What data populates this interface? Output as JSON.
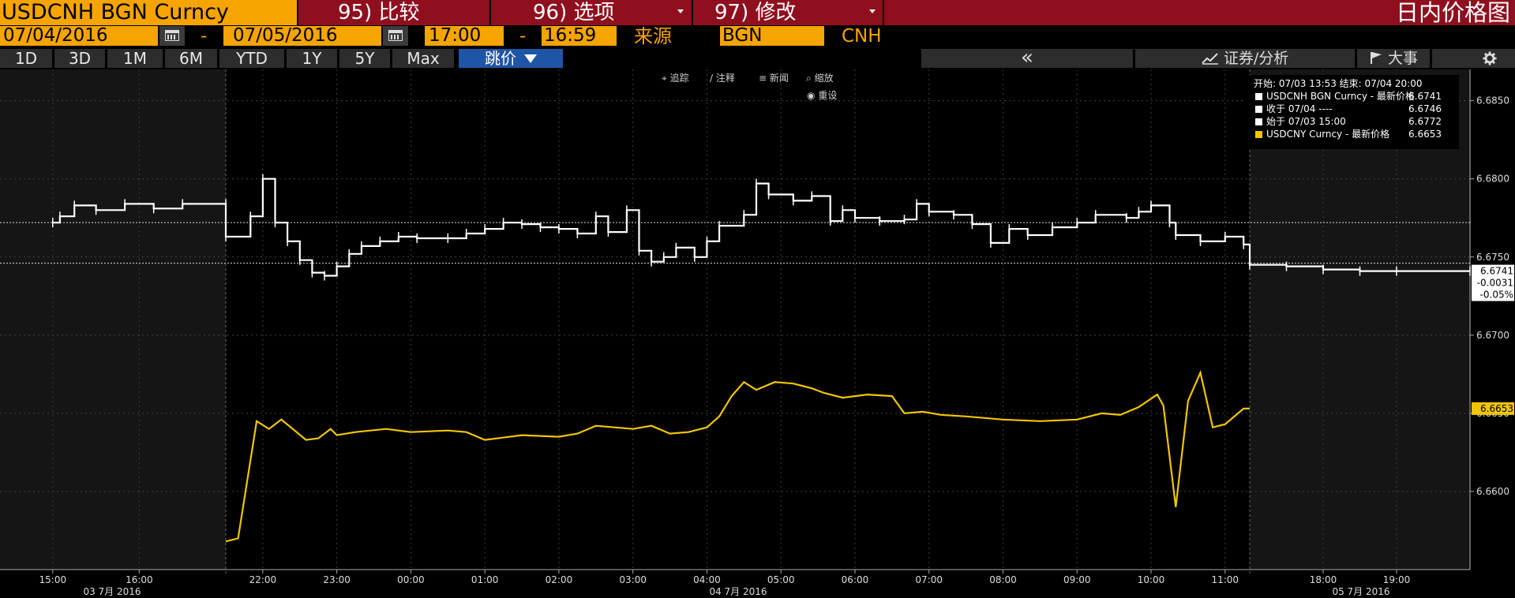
{
  "topbar": {
    "ticker": "USDCNH BGN Curncy",
    "menu": [
      {
        "num": "95)",
        "label": "比较"
      },
      {
        "num": "96)",
        "label": "选项"
      },
      {
        "num": "97)",
        "label": "修改"
      }
    ],
    "title": "日内价格图"
  },
  "range": {
    "start_date": "07/04/2016",
    "end_date": "07/05/2016",
    "start_time": "17:00",
    "end_time": "16:59",
    "dash": "-",
    "source_label": "来源",
    "source_value": "BGN",
    "currency": "CNH"
  },
  "periods": [
    "1D",
    "3D",
    "1M",
    "6M",
    "YTD",
    "1Y",
    "5Y",
    "Max"
  ],
  "mode_button": "跳价",
  "right_toolbar": {
    "collapse": "«",
    "analysis": "证券/分析",
    "events": "大事",
    "settings_icon": "gear-icon"
  },
  "chart_tools": {
    "track": "追踪",
    "annotate": "注释",
    "news": "新闻",
    "zoom": "缩放",
    "reset": "重设"
  },
  "legend": {
    "header": "开始: 07/03 13:53 结束: 07/04 20:00",
    "rows": [
      {
        "label": "USDCNH BGN Curncy - 最新价格",
        "value": "6.6741",
        "color": "#ffffff"
      },
      {
        "label": "收于 07/04 ----",
        "value": "6.6746",
        "color": "#ffffff"
      },
      {
        "label": "始于 07/03 15:00",
        "value": "6.6772",
        "color": "#ffffff"
      },
      {
        "label": "USDCNY Curncy - 最新价格",
        "value": "6.6653",
        "color": "#f2c500"
      }
    ]
  },
  "colors": {
    "cnh_line": "#ffffff",
    "cny_line": "#f2c500",
    "amber": "#f5a400",
    "topbar": "#8f0f1f"
  },
  "chart_data": {
    "type": "line",
    "y_axis": {
      "ylim": [
        6.655,
        6.687
      ],
      "ticks": [
        "6.6850",
        "6.6800",
        "6.6750",
        "6.6700",
        "6.6650",
        "6.6600"
      ],
      "position": "right"
    },
    "x_axis": {
      "ticks": [
        "15:00",
        "16:00",
        "22:00",
        "23:00",
        "00:00",
        "01:00",
        "02:00",
        "03:00",
        "04:00",
        "05:00",
        "06:00",
        "07:00",
        "08:00",
        "09:00",
        "10:00",
        "11:00",
        "18:00",
        "19:00"
      ],
      "date_labels": [
        "03 7月 2016",
        "04 7月 2016",
        "05 7月 2016"
      ]
    },
    "last_value_tags": [
      {
        "text": "6.6741",
        "series": "USDCNH BGN Curncy"
      },
      {
        "text": "-0.0031",
        "series": "USDCNH BGN Curncy"
      },
      {
        "text": "-0.05%",
        "series": "USDCNH BGN Curncy"
      },
      {
        "text": "6.6653",
        "series": "USDCNY Curncy"
      }
    ],
    "reference_lines": [
      6.6772,
      6.6746
    ],
    "series": [
      {
        "name": "USDCNH BGN Curncy",
        "color": "#ffffff",
        "step": true,
        "points": [
          [
            "15:00",
            6.6772
          ],
          [
            "15:05",
            6.6776
          ],
          [
            "15:15",
            6.6783
          ],
          [
            "15:30",
            6.678
          ],
          [
            "15:50",
            6.6784
          ],
          [
            "16:10",
            6.6781
          ],
          [
            "16:30",
            6.6784
          ],
          [
            "17:00",
            6.6784
          ],
          [
            "21:30",
            6.6763
          ],
          [
            "21:50",
            6.6776
          ],
          [
            "22:00",
            6.68
          ],
          [
            "22:10",
            6.6772
          ],
          [
            "22:20",
            6.676
          ],
          [
            "22:30",
            6.6748
          ],
          [
            "22:40",
            6.674
          ],
          [
            "22:50",
            6.6738
          ],
          [
            "23:00",
            6.6744
          ],
          [
            "23:10",
            6.6752
          ],
          [
            "23:20",
            6.6757
          ],
          [
            "23:35",
            6.676
          ],
          [
            "23:50",
            6.6763
          ],
          [
            "00:05",
            6.6762
          ],
          [
            "00:30",
            6.6762
          ],
          [
            "00:45",
            6.6765
          ],
          [
            "01:00",
            6.6768
          ],
          [
            "01:15",
            6.6772
          ],
          [
            "01:30",
            6.6771
          ],
          [
            "01:45",
            6.6769
          ],
          [
            "02:00",
            6.6768
          ],
          [
            "02:15",
            6.6765
          ],
          [
            "02:30",
            6.6776
          ],
          [
            "02:40",
            6.6766
          ],
          [
            "02:55",
            6.678
          ],
          [
            "03:05",
            6.6754
          ],
          [
            "03:15",
            6.6747
          ],
          [
            "03:25",
            6.675
          ],
          [
            "03:35",
            6.6756
          ],
          [
            "03:50",
            6.675
          ],
          [
            "04:00",
            6.676
          ],
          [
            "04:10",
            6.677
          ],
          [
            "04:30",
            6.6777
          ],
          [
            "04:40",
            6.6797
          ],
          [
            "04:50",
            6.679
          ],
          [
            "05:10",
            6.6786
          ],
          [
            "05:25",
            6.6789
          ],
          [
            "05:40",
            6.6773
          ],
          [
            "05:50",
            6.678
          ],
          [
            "06:00",
            6.6775
          ],
          [
            "06:20",
            6.6773
          ],
          [
            "06:40",
            6.6774
          ],
          [
            "06:50",
            6.6784
          ],
          [
            "07:00",
            6.6779
          ],
          [
            "07:20",
            6.6777
          ],
          [
            "07:35",
            6.6771
          ],
          [
            "07:50",
            6.6759
          ],
          [
            "08:05",
            6.6768
          ],
          [
            "08:20",
            6.6764
          ],
          [
            "08:40",
            6.6769
          ],
          [
            "09:00",
            6.6772
          ],
          [
            "09:15",
            6.6777
          ],
          [
            "09:40",
            6.6775
          ],
          [
            "09:50",
            6.6779
          ],
          [
            "10:00",
            6.6783
          ],
          [
            "10:15",
            6.6772
          ],
          [
            "10:20",
            6.6764
          ],
          [
            "10:40",
            6.676
          ],
          [
            "11:00",
            6.6763
          ],
          [
            "11:15",
            6.6758
          ],
          [
            "11:20",
            6.6752
          ],
          [
            "17:00",
            6.6745
          ],
          [
            "17:30",
            6.6744
          ],
          [
            "18:00",
            6.6742
          ],
          [
            "18:30",
            6.6741
          ],
          [
            "19:00",
            6.6741
          ],
          [
            "20:00",
            6.6741
          ]
        ]
      },
      {
        "name": "USDCNY Curncy",
        "color": "#f2c500",
        "step": false,
        "points": [
          [
            "21:30",
            6.6568
          ],
          [
            "21:40",
            6.657
          ],
          [
            "21:55",
            6.6645
          ],
          [
            "22:05",
            6.664
          ],
          [
            "22:15",
            6.6646
          ],
          [
            "22:35",
            6.6633
          ],
          [
            "22:45",
            6.6634
          ],
          [
            "22:55",
            6.664
          ],
          [
            "23:00",
            6.6636
          ],
          [
            "23:15",
            6.6638
          ],
          [
            "23:40",
            6.664
          ],
          [
            "00:00",
            6.6638
          ],
          [
            "00:30",
            6.6639
          ],
          [
            "00:45",
            6.6638
          ],
          [
            "01:00",
            6.6633
          ],
          [
            "01:30",
            6.6636
          ],
          [
            "02:00",
            6.6635
          ],
          [
            "02:15",
            6.6637
          ],
          [
            "02:30",
            6.6642
          ],
          [
            "02:45",
            6.6641
          ],
          [
            "03:00",
            6.664
          ],
          [
            "03:15",
            6.6642
          ],
          [
            "03:30",
            6.6637
          ],
          [
            "03:45",
            6.6638
          ],
          [
            "04:00",
            6.6641
          ],
          [
            "04:10",
            6.6648
          ],
          [
            "04:20",
            6.6661
          ],
          [
            "04:30",
            6.667
          ],
          [
            "04:40",
            6.6665
          ],
          [
            "04:55",
            6.667
          ],
          [
            "05:10",
            6.6669
          ],
          [
            "05:25",
            6.6666
          ],
          [
            "05:35",
            6.6663
          ],
          [
            "05:50",
            6.666
          ],
          [
            "06:10",
            6.6662
          ],
          [
            "06:30",
            6.6661
          ],
          [
            "06:40",
            6.665
          ],
          [
            "06:55",
            6.6651
          ],
          [
            "07:10",
            6.6649
          ],
          [
            "07:30",
            6.6648
          ],
          [
            "08:00",
            6.6646
          ],
          [
            "08:30",
            6.6645
          ],
          [
            "09:00",
            6.6646
          ],
          [
            "09:20",
            6.665
          ],
          [
            "09:35",
            6.6649
          ],
          [
            "09:50",
            6.6654
          ],
          [
            "10:05",
            6.6662
          ],
          [
            "10:10",
            6.6655
          ],
          [
            "10:20",
            6.659
          ],
          [
            "10:30",
            6.6658
          ],
          [
            "10:40",
            6.6676
          ],
          [
            "10:50",
            6.6641
          ],
          [
            "11:00",
            6.6643
          ],
          [
            "11:15",
            6.6653
          ],
          [
            "11:20",
            6.6653
          ]
        ]
      }
    ]
  }
}
